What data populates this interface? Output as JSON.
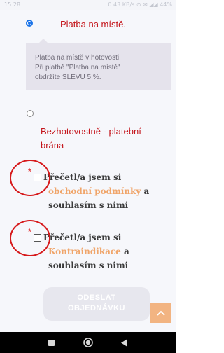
{
  "status_bar": {
    "time": "15:28",
    "right_text": "0.43 KB/s ⊙ ✉ ◢◢ 44%"
  },
  "payment_options": [
    {
      "label": "Platba na místě.",
      "selected": true
    },
    {
      "label_line1": "Bezhotovostně - platební",
      "label_line2": "brána",
      "selected": false
    }
  ],
  "info_box": {
    "line1": "Platba na místě v hotovosti.",
    "line2": "Při platbě \"Platba na místě\"",
    "line3": "obdržíte SLEVU 5 %."
  },
  "consents": [
    {
      "required_mark": "*",
      "text_before": "Přečetl/a jsem si",
      "link": "obchodní podmínky",
      "text_after": " a",
      "line3": "souhlasím s nimi"
    },
    {
      "required_mark": "*",
      "text_before": "Přečetl/a jsem si",
      "link": "Kontraindikace",
      "text_after": " a",
      "line3": "souhlasím s nimi"
    }
  ],
  "submit_button": {
    "line1": "ODESLAT",
    "line2": "OBJEDNÁVKU"
  },
  "colors": {
    "accent_red": "#c4161c",
    "link_orange": "#f0a56a",
    "radio_blue": "#1a73e8",
    "scroll_button": "#f2b482"
  },
  "icons": {
    "scroll_top": "chevron-up-icon",
    "nav_recents": "square-icon",
    "nav_home": "circle-icon",
    "nav_back": "triangle-back-icon"
  }
}
